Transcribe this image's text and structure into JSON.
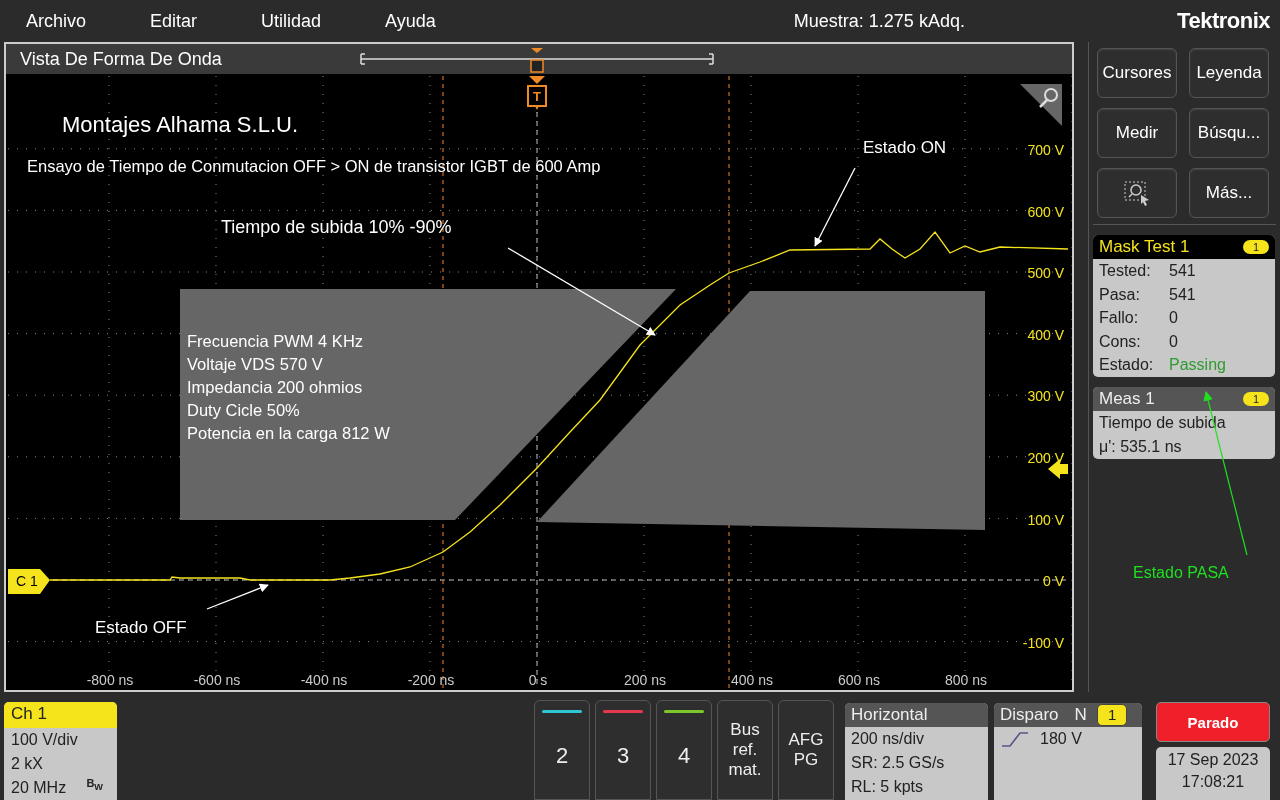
{
  "menu": [
    "Archivo",
    "Editar",
    "Utilidad",
    "Ayuda"
  ],
  "acquisition": "Muestra: 1.275 kAdq.",
  "brand": "Tektronix",
  "waveform_view": {
    "title": "Vista De Forma De Onda",
    "trigger_mark": "T",
    "company": "Montajes Alhama S.L.U.",
    "subtitle": "Ensayo de Tiempo de Conmutacion OFF > ON de transistor IGBT de 600 Amp",
    "rise_label": "Tiempo de subida 10% -90%",
    "on_label": "Estado ON",
    "off_label": "Estado OFF",
    "settings": [
      "Frecuencia PWM 4 KHz",
      "Voltaje VDS 570 V",
      "Impedancia 200 ohmios",
      "Duty Cicle 50%",
      "Potencia en la carga  812 W"
    ],
    "channel_marker": "C 1",
    "y_labels": [
      "700 V",
      "600 V",
      "500 V",
      "400 V",
      "300 V",
      "200 V",
      "100 V",
      "0 V",
      "-100 V"
    ],
    "x_labels": [
      "-800 ns",
      "-600 ns",
      "-400 ns",
      "-200 ns",
      "0 s",
      "200 ns",
      "400 ns",
      "600 ns",
      "800 ns"
    ]
  },
  "side_buttons": [
    {
      "kind": "text",
      "label": "Cursores"
    },
    {
      "kind": "text",
      "label": "Leyenda"
    },
    {
      "kind": "text",
      "label": "Medir"
    },
    {
      "kind": "text",
      "label": "Búsqu..."
    },
    {
      "kind": "zoom"
    },
    {
      "kind": "text",
      "label": "Más..."
    }
  ],
  "mask_test": {
    "title": "Mask Test 1",
    "badge": "1",
    "rows": [
      {
        "label": "Tested:",
        "value": "541"
      },
      {
        "label": "Pasa:",
        "value": "541"
      },
      {
        "label": "Fallo:",
        "value": "0"
      },
      {
        "label": "Cons:",
        "value": "0"
      },
      {
        "label": "Estado:",
        "value": "Passing",
        "passing": true
      }
    ]
  },
  "meas": {
    "title": "Meas 1",
    "badge": "1",
    "name": "Tiempo de subida",
    "value": "μ': 535.1 ns"
  },
  "note": "Estado PASA",
  "ch1": {
    "title": "Ch 1",
    "lines": [
      "100 V/div",
      "2 kX",
      "20 MHz"
    ],
    "bw": "B$_{W}$"
  },
  "channels": [
    {
      "label": "2",
      "color": "#2ec6d3"
    },
    {
      "label": "3",
      "color": "#e8384f"
    },
    {
      "label": "4",
      "color": "#7cc72a"
    }
  ],
  "tools": [
    [
      "Bus",
      "ref.",
      "mat."
    ],
    [
      "AFG",
      "PG"
    ]
  ],
  "horizontal": {
    "title": "Horizontal",
    "lines": [
      "200 ns/div",
      "SR: 2.5 GS/s",
      "RL: 5 kpts"
    ]
  },
  "trigger": {
    "title": "Disparo",
    "mode": "N",
    "badge": "1",
    "level": "180 V"
  },
  "run_state": "Parado",
  "date": "17 Sep 2023",
  "time": "17:08:21"
}
